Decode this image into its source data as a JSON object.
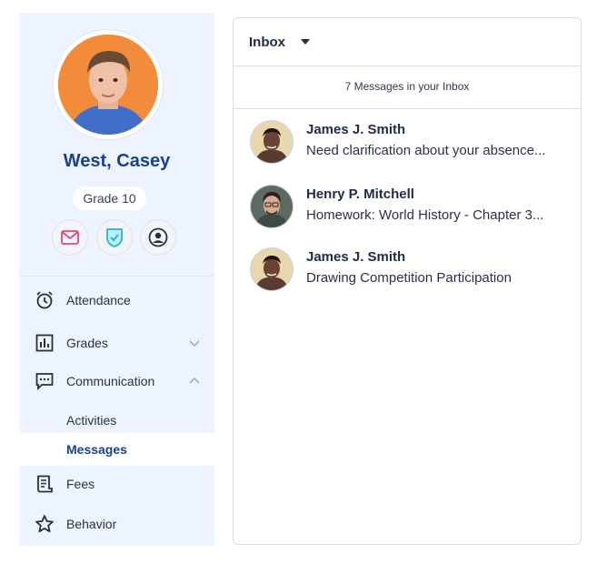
{
  "student": {
    "name": "West, Casey",
    "grade": "Grade 10"
  },
  "quick_actions": [
    {
      "icon": "mail-icon",
      "color": "#e0457b"
    },
    {
      "icon": "shield-check-icon",
      "color": "#2bb3c9"
    },
    {
      "icon": "user-circle-icon",
      "color": "#2a2f3a"
    }
  ],
  "nav": {
    "attendance": "Attendance",
    "grades": "Grades",
    "communication": "Communication",
    "communication_sub": [
      "Activities",
      "Messages"
    ],
    "fees": "Fees",
    "behavior": "Behavior"
  },
  "inbox": {
    "title": "Inbox",
    "count_text": "7 Messages in your Inbox",
    "messages": [
      {
        "sender": "James J. Smith",
        "subject": "Need clarification about your absence..."
      },
      {
        "sender": "Henry P. Mitchell",
        "subject": "Homework: World History - Chapter 3..."
      },
      {
        "sender": "James J. Smith",
        "subject": "Drawing Competition Participation"
      }
    ]
  },
  "colors": {
    "accent": "#1b3f8f",
    "sidebar_bg": "#edf4ff",
    "avatar_bg": "#f28c3a"
  }
}
